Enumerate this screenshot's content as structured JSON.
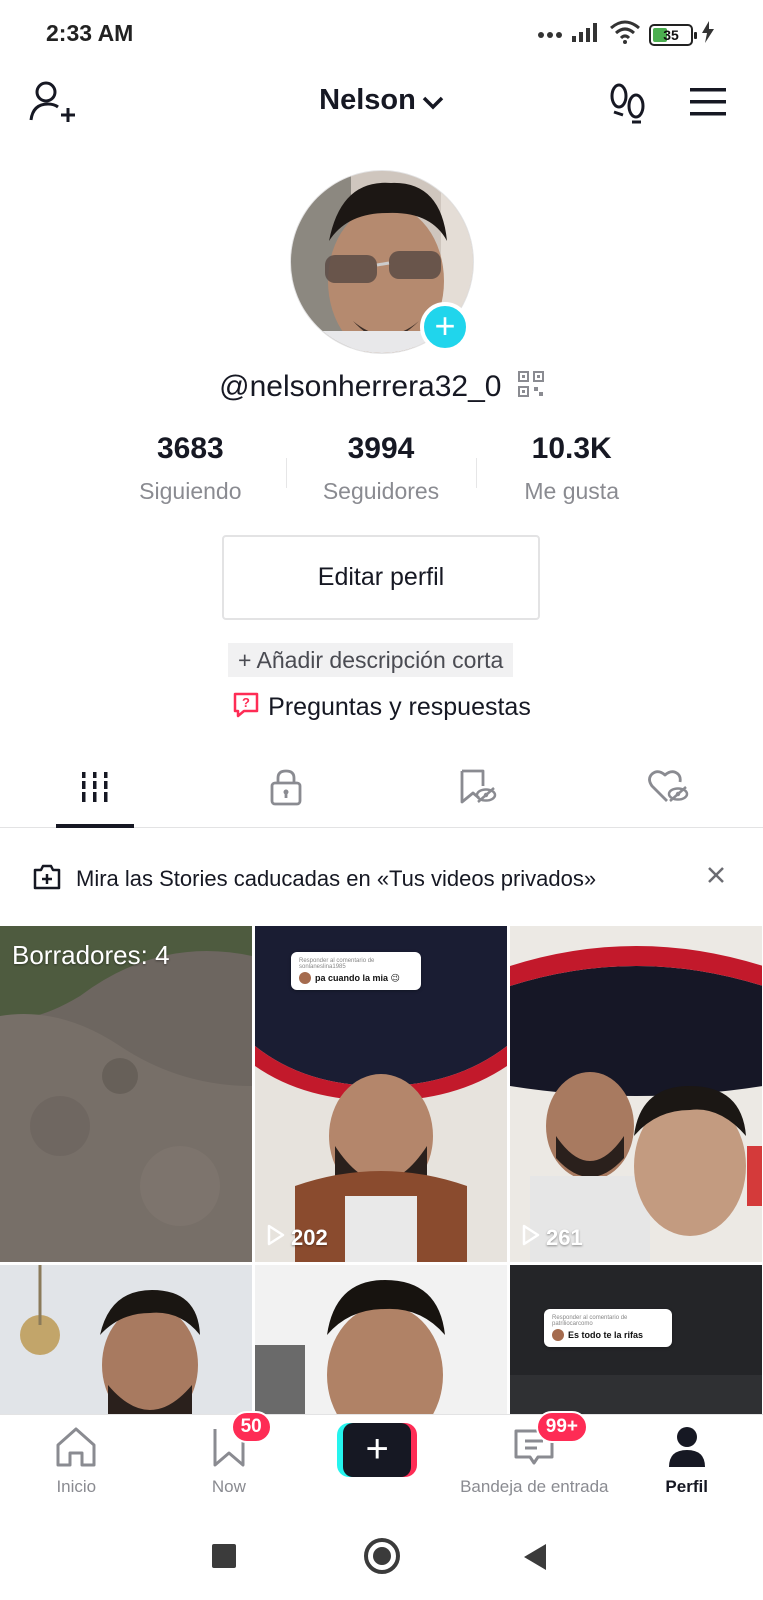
{
  "status_bar": {
    "time": "2:33 AM",
    "battery_level": "35",
    "icons": [
      "dots-icon",
      "signal-icon",
      "wifi-icon",
      "battery-icon",
      "charging-icon"
    ]
  },
  "header": {
    "title": "Nelson",
    "icons": [
      "add-user-icon",
      "chevron-down-icon",
      "footprints-icon",
      "menu-icon"
    ]
  },
  "profile": {
    "username": "@nelsonherrera32_0",
    "stats": [
      {
        "value": "3683",
        "label": "Siguiendo"
      },
      {
        "value": "3994",
        "label": "Seguidores"
      },
      {
        "value": "10.3K",
        "label": "Me gusta"
      }
    ],
    "edit_button": "Editar perfil",
    "add_bio": "+ Añadir descripción corta",
    "qa_label": "Preguntas y respuestas"
  },
  "tabs": [
    "videos-grid-icon",
    "lock-icon",
    "hidden-bookmark-icon",
    "hidden-heart-icon"
  ],
  "banner": {
    "text": "Mira las Stories caducadas en «Tus videos privados»"
  },
  "grid": {
    "drafts_label": "Borradores: 4",
    "videos": [
      {
        "views": "202",
        "bubble_small": "Responder al comentario de sonlaneslina1985",
        "bubble_text": "pa cuando la mia 😉"
      },
      {
        "views": "261"
      },
      {},
      {},
      {
        "bubble_small": "Responder al comentario de patriliocarcomo",
        "bubble_text": "Es todo te la rifas"
      }
    ]
  },
  "bottom_nav": {
    "items": [
      {
        "label": "Inicio"
      },
      {
        "label": "Now",
        "badge": "50"
      },
      {
        "label": ""
      },
      {
        "label": "Bandeja de entrada",
        "badge": "99+"
      },
      {
        "label": "Perfil"
      }
    ]
  },
  "colors": {
    "accent_red": "#fe2c55",
    "accent_cyan": "#20d5ec",
    "text_primary": "#161823",
    "text_secondary": "#8a8b91"
  }
}
